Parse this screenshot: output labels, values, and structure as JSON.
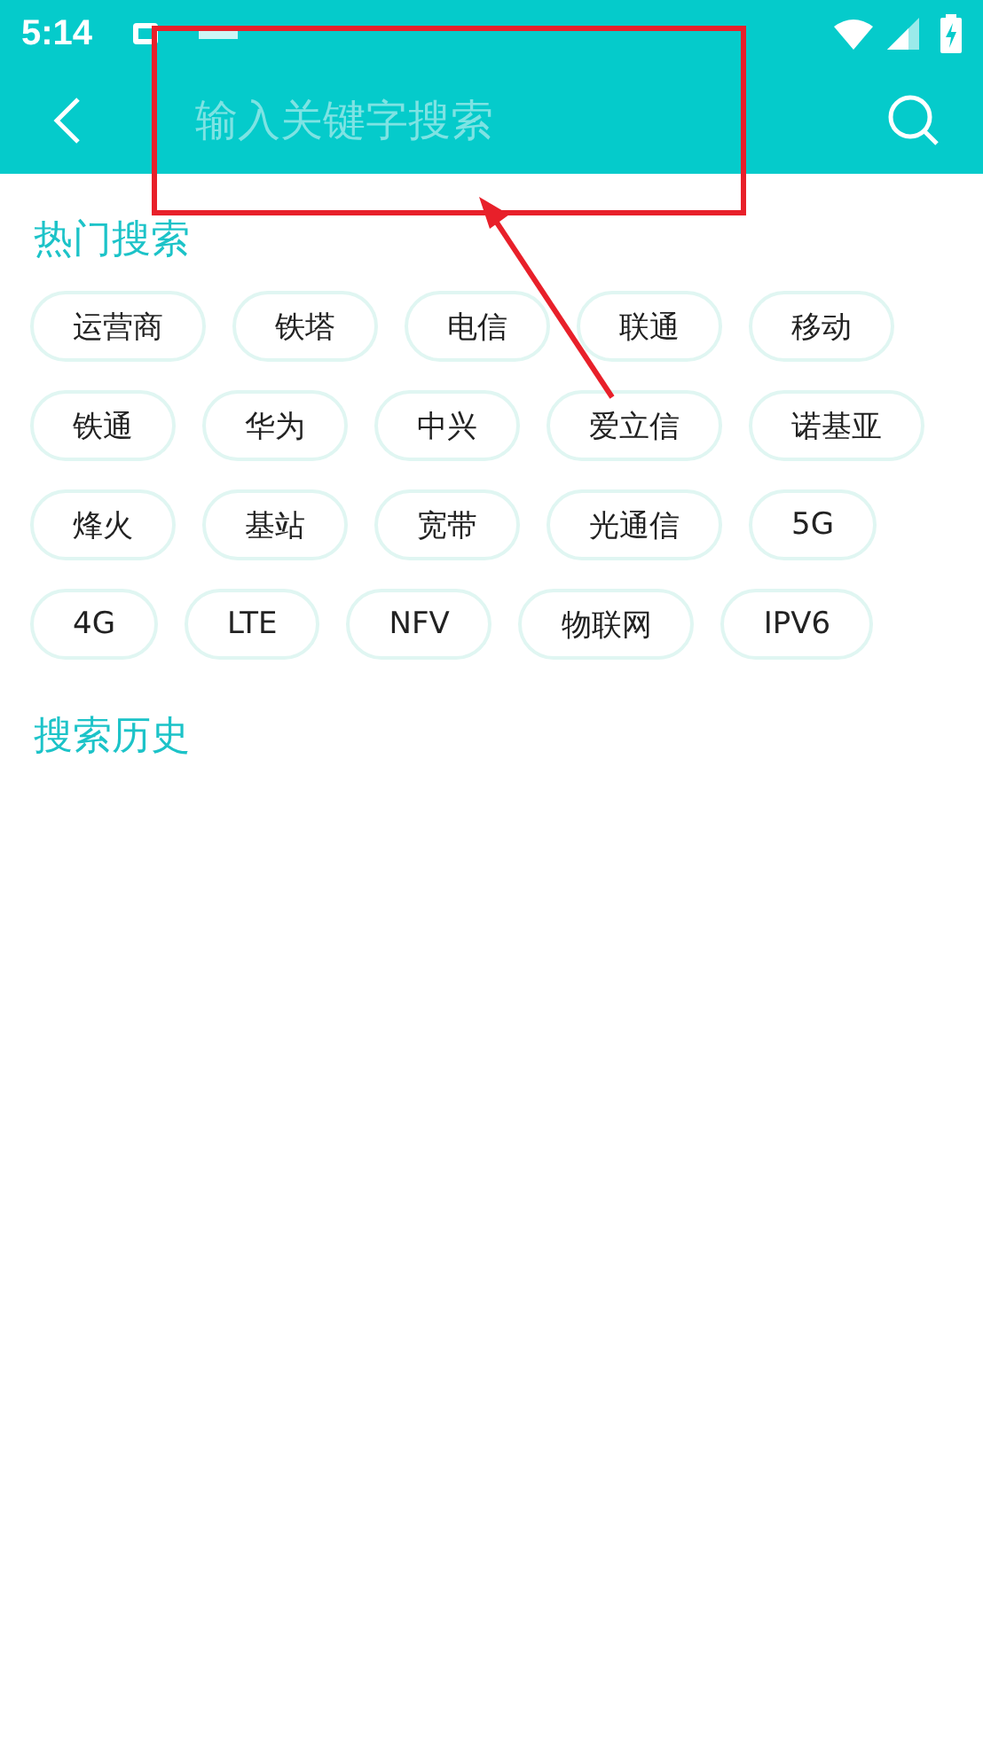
{
  "status_bar": {
    "time": "5:14"
  },
  "app_bar": {
    "search": {
      "placeholder": "输入关键字搜索"
    }
  },
  "hot_search": {
    "title": "热门搜索",
    "rows": [
      [
        "运营商",
        "铁塔",
        "电信",
        "联通",
        "移动"
      ],
      [
        "铁通",
        "华为",
        "中兴",
        "爱立信",
        "诺基亚"
      ],
      [
        "烽火",
        "基站",
        "宽带",
        "光通信",
        "5G"
      ],
      [
        "4G",
        "LTE",
        "NFV",
        "物联网",
        "IPV6"
      ]
    ]
  },
  "history": {
    "title": "搜索历史"
  }
}
